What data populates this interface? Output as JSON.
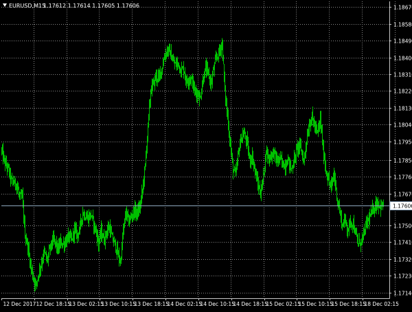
{
  "window": {
    "symbol_timeframe": "EURUSD,M15",
    "ohlc": "1.17612 1.17614 1.17605 1.17606",
    "collapse_icon": "triangle-down-icon"
  },
  "colors": {
    "background": "#000000",
    "grid": "#8a8a8a",
    "axis": "#c8c8c8",
    "text": "#ffffff",
    "bar": "#00c000",
    "price_line": "#8fa8bf",
    "price_label_bg": "#ffffff",
    "price_label_text": "#000000"
  },
  "chart_data": {
    "type": "ohlc-bars",
    "symbol": "EURUSD",
    "timeframe": "M15",
    "current_price": 1.17606,
    "ylim": [
      1.1711,
      1.187
    ],
    "y_ticks": [
      1.1714,
      1.1723,
      1.1732,
      1.1741,
      1.175,
      1.1767,
      1.1776,
      1.1785,
      1.1795,
      1.1804,
      1.1813,
      1.1822,
      1.1831,
      1.184,
      1.1849,
      1.1858,
      1.1867
    ],
    "y_tick_labels": [
      "1.17140",
      "1.17230",
      "1.17320",
      "1.17410",
      "1.17500",
      "1.17670",
      "1.17760",
      "1.17850",
      "1.17950",
      "1.18040",
      "1.18130",
      "1.18220",
      "1.18310",
      "1.18400",
      "1.18490",
      "1.18580",
      "1.18670"
    ],
    "x_ticks": [
      0,
      48,
      96,
      144,
      192,
      240,
      288,
      336,
      384,
      432,
      480,
      528
    ],
    "x_tick_labels": [
      "12 Dec 2017",
      "12 Dec 18:15",
      "13 Dec 02:15",
      "13 Dec 10:15",
      "13 Dec 18:15",
      "14 Dec 02:15",
      "14 Dec 10:15",
      "14 Dec 18:15",
      "15 Dec 02:15",
      "15 Dec 10:15",
      "15 Dec 18:15",
      "18 Dec 02:15"
    ],
    "grid": true,
    "close_path": [
      [
        0,
        1.179
      ],
      [
        4,
        1.1784
      ],
      [
        10,
        1.178
      ],
      [
        14,
        1.1774
      ],
      [
        18,
        1.1773
      ],
      [
        22,
        1.1772
      ],
      [
        26,
        1.1765
      ],
      [
        30,
        1.1765
      ],
      [
        34,
        1.1745
      ],
      [
        38,
        1.1739
      ],
      [
        42,
        1.1729
      ],
      [
        46,
        1.1722
      ],
      [
        50,
        1.1718
      ],
      [
        54,
        1.1725
      ],
      [
        58,
        1.173
      ],
      [
        62,
        1.1736
      ],
      [
        66,
        1.1731
      ],
      [
        70,
        1.1737
      ],
      [
        74,
        1.1742
      ],
      [
        78,
        1.1741
      ],
      [
        82,
        1.1737
      ],
      [
        86,
        1.1741
      ],
      [
        90,
        1.174
      ],
      [
        94,
        1.1742
      ],
      [
        98,
        1.1744
      ],
      [
        102,
        1.1742
      ],
      [
        106,
        1.1748
      ],
      [
        110,
        1.1745
      ],
      [
        114,
        1.1749
      ],
      [
        118,
        1.1757
      ],
      [
        122,
        1.1755
      ],
      [
        126,
        1.1754
      ],
      [
        130,
        1.1756
      ],
      [
        134,
        1.1751
      ],
      [
        138,
        1.1746
      ],
      [
        142,
        1.174
      ],
      [
        146,
        1.1747
      ],
      [
        150,
        1.1742
      ],
      [
        154,
        1.1747
      ],
      [
        158,
        1.1749
      ],
      [
        162,
        1.1743
      ],
      [
        166,
        1.174
      ],
      [
        170,
        1.1735
      ],
      [
        174,
        1.173
      ],
      [
        178,
        1.1747
      ],
      [
        182,
        1.1757
      ],
      [
        186,
        1.1752
      ],
      [
        190,
        1.1755
      ],
      [
        194,
        1.1758
      ],
      [
        198,
        1.1757
      ],
      [
        202,
        1.1759
      ],
      [
        206,
        1.1769
      ],
      [
        210,
        1.1782
      ],
      [
        214,
        1.1803
      ],
      [
        218,
        1.1822
      ],
      [
        222,
        1.1826
      ],
      [
        226,
        1.183
      ],
      [
        230,
        1.1829
      ],
      [
        234,
        1.1834
      ],
      [
        238,
        1.184
      ],
      [
        242,
        1.1844
      ],
      [
        246,
        1.1843
      ],
      [
        250,
        1.1838
      ],
      [
        254,
        1.1836
      ],
      [
        258,
        1.1837
      ],
      [
        262,
        1.1833
      ],
      [
        266,
        1.1834
      ],
      [
        270,
        1.1827
      ],
      [
        274,
        1.1829
      ],
      [
        278,
        1.1828
      ],
      [
        282,
        1.1822
      ],
      [
        286,
        1.1821
      ],
      [
        290,
        1.1818
      ],
      [
        294,
        1.1828
      ],
      [
        298,
        1.1834
      ],
      [
        302,
        1.1831
      ],
      [
        306,
        1.1826
      ],
      [
        310,
        1.1834
      ],
      [
        314,
        1.184
      ],
      [
        318,
        1.1843
      ],
      [
        322,
        1.1848
      ],
      [
        326,
        1.1822
      ],
      [
        330,
        1.1808
      ],
      [
        334,
        1.1793
      ],
      [
        338,
        1.178
      ],
      [
        342,
        1.1777
      ],
      [
        346,
        1.179
      ],
      [
        350,
        1.1797
      ],
      [
        354,
        1.1799
      ],
      [
        358,
        1.1795
      ],
      [
        362,
        1.1785
      ],
      [
        366,
        1.1787
      ],
      [
        370,
        1.1779
      ],
      [
        374,
        1.1772
      ],
      [
        378,
        1.1767
      ],
      [
        382,
        1.1776
      ],
      [
        386,
        1.179
      ],
      [
        390,
        1.1786
      ],
      [
        394,
        1.1788
      ],
      [
        398,
        1.1789
      ],
      [
        402,
        1.1784
      ],
      [
        406,
        1.1786
      ],
      [
        410,
        1.1783
      ],
      [
        414,
        1.1782
      ],
      [
        418,
        1.1786
      ],
      [
        422,
        1.178
      ],
      [
        426,
        1.1782
      ],
      [
        430,
        1.1788
      ],
      [
        434,
        1.1793
      ],
      [
        438,
        1.1791
      ],
      [
        442,
        1.1784
      ],
      [
        446,
        1.1796
      ],
      [
        450,
        1.1804
      ],
      [
        454,
        1.1808
      ],
      [
        458,
        1.1803
      ],
      [
        462,
        1.1799
      ],
      [
        466,
        1.1807
      ],
      [
        470,
        1.1791
      ],
      [
        474,
        1.178
      ],
      [
        478,
        1.1774
      ],
      [
        482,
        1.177
      ],
      [
        486,
        1.1778
      ],
      [
        490,
        1.1766
      ],
      [
        494,
        1.1758
      ],
      [
        498,
        1.175
      ],
      [
        502,
        1.1753
      ],
      [
        506,
        1.1748
      ],
      [
        510,
        1.1752
      ],
      [
        514,
        1.1751
      ],
      [
        518,
        1.1744
      ],
      [
        522,
        1.174
      ],
      [
        526,
        1.1742
      ],
      [
        530,
        1.1746
      ],
      [
        534,
        1.1752
      ],
      [
        538,
        1.1754
      ],
      [
        542,
        1.1758
      ],
      [
        546,
        1.1761
      ],
      [
        550,
        1.1762
      ],
      [
        554,
        1.176
      ],
      [
        558,
        1.1761
      ]
    ]
  }
}
